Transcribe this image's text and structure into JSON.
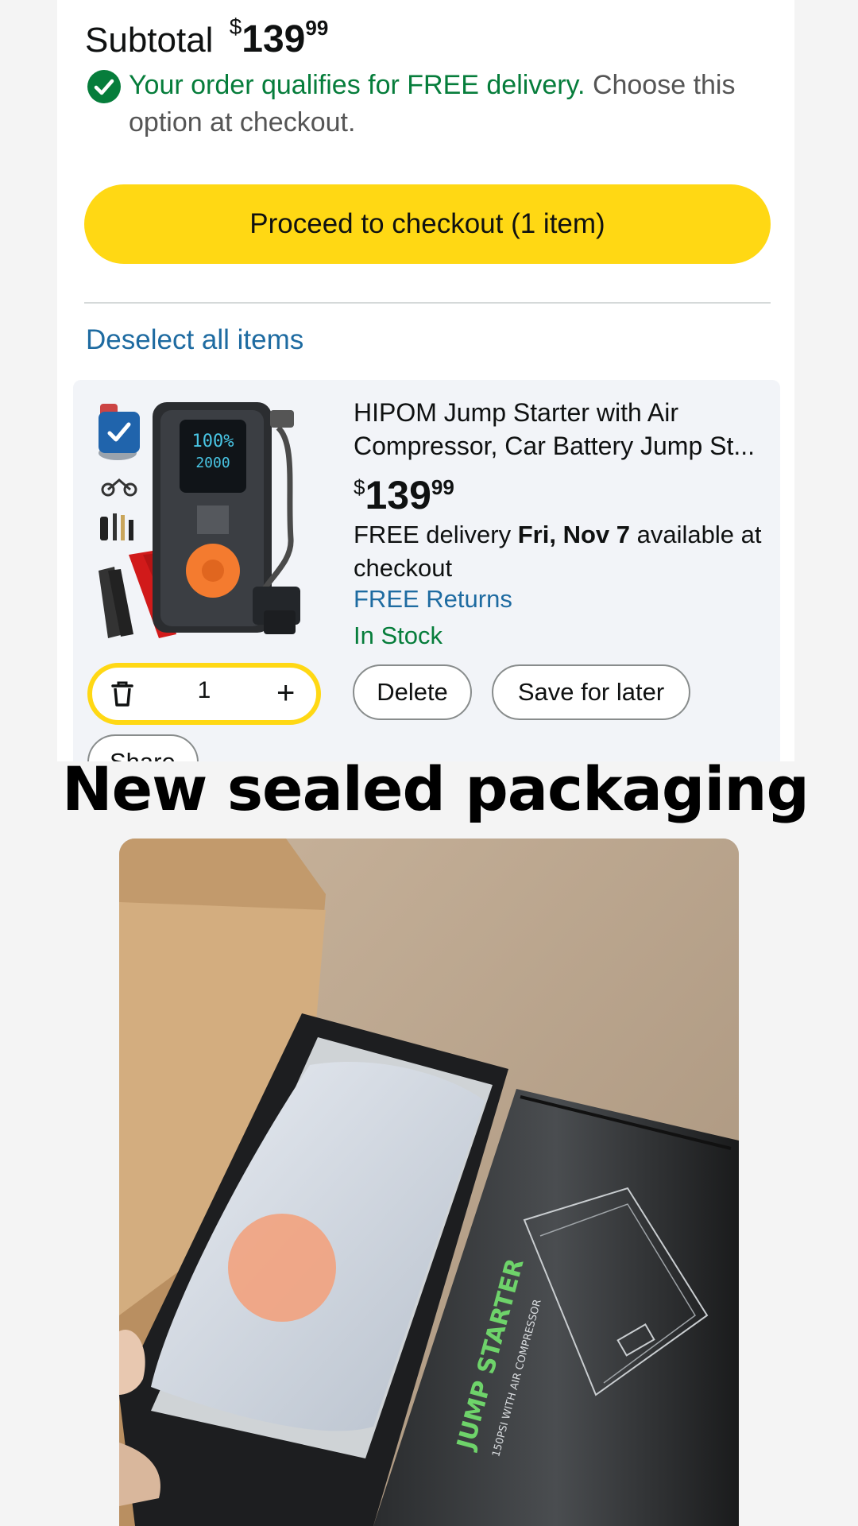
{
  "cart": {
    "subtotal_label": "Subtotal",
    "subtotal_symbol": "$",
    "subtotal_whole": "139",
    "subtotal_cents": "99",
    "qualifies_green": "Your order qualifies for FREE delivery.",
    "qualifies_rest": "Choose this option at checkout.",
    "checkout_button": "Proceed to checkout (1 item)",
    "deselect_link": "Deselect all items"
  },
  "item": {
    "title": "HIPOM Jump Starter with Air Compressor, Car Battery Jump St...",
    "price_symbol": "$",
    "price_whole": "139",
    "price_cents": "99",
    "delivery_prefix": "FREE delivery",
    "delivery_date": "Fri, Nov 7",
    "delivery_suffix": "available at checkout",
    "returns": "FREE Returns",
    "stock": "In Stock",
    "quantity": "1",
    "delete_button": "Delete",
    "save_button": "Save for later",
    "share_button": "Share",
    "screen_top": "100%",
    "screen_bottom": "2000"
  },
  "caption": "New sealed packaging",
  "photo": {
    "box_text": "JUMP STARTER",
    "box_subtext": "150PSI   WITH AIR COMPRESSOR"
  },
  "colors": {
    "checkout_yellow": "#ffd814",
    "link_blue": "#1e6ba1",
    "success_green": "#067d3b",
    "checkbox_blue": "#2064ac",
    "device_orange": "#f47b2f"
  }
}
